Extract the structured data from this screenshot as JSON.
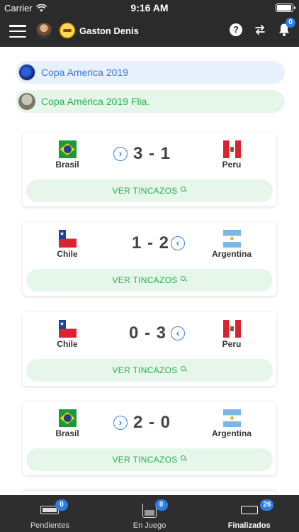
{
  "status_bar": {
    "carrier": "Carrier",
    "time": "9:16 AM",
    "battery_level": 1.0
  },
  "nav": {
    "username": "Gaston Denis",
    "help_label": "?",
    "notification_count": "0",
    "icons": [
      "menu-icon",
      "avatar",
      "avatar",
      "help-icon",
      "swap-icon",
      "bell-icon"
    ]
  },
  "tournaments": [
    {
      "label": "Copa America 2019",
      "color": "#3a78d8"
    },
    {
      "label": "Copa América 2019 Flia.",
      "color": "#27b34a"
    }
  ],
  "matches": [
    {
      "home": "Brasil",
      "away": "Peru",
      "score": "3 - 1",
      "arrow": "right",
      "button": "VER TINCAZOS"
    },
    {
      "home": "Chile",
      "away": "Argentina",
      "score": "1 - 2",
      "arrow": "left",
      "button": "VER TINCAZOS"
    },
    {
      "home": "Chile",
      "away": "Peru",
      "score": "0 - 3",
      "arrow": "left",
      "button": "VER TINCAZOS"
    },
    {
      "home": "Brasil",
      "away": "Argentina",
      "score": "2 - 0",
      "arrow": "right",
      "button": "VER TINCAZOS"
    }
  ],
  "tabs": [
    {
      "label": "Pendientes",
      "badge": "0"
    },
    {
      "label": "En Juego",
      "badge": "0"
    },
    {
      "label": "Finalizados",
      "badge": "26",
      "active": true
    }
  ],
  "colors": {
    "bar_background": "#2b2b2b",
    "accent_blue": "#2d7ee6",
    "accent_green": "#27b34a",
    "pill_blue_bg": "#e8f0fb",
    "pill_green_bg": "#e6f6ea"
  }
}
